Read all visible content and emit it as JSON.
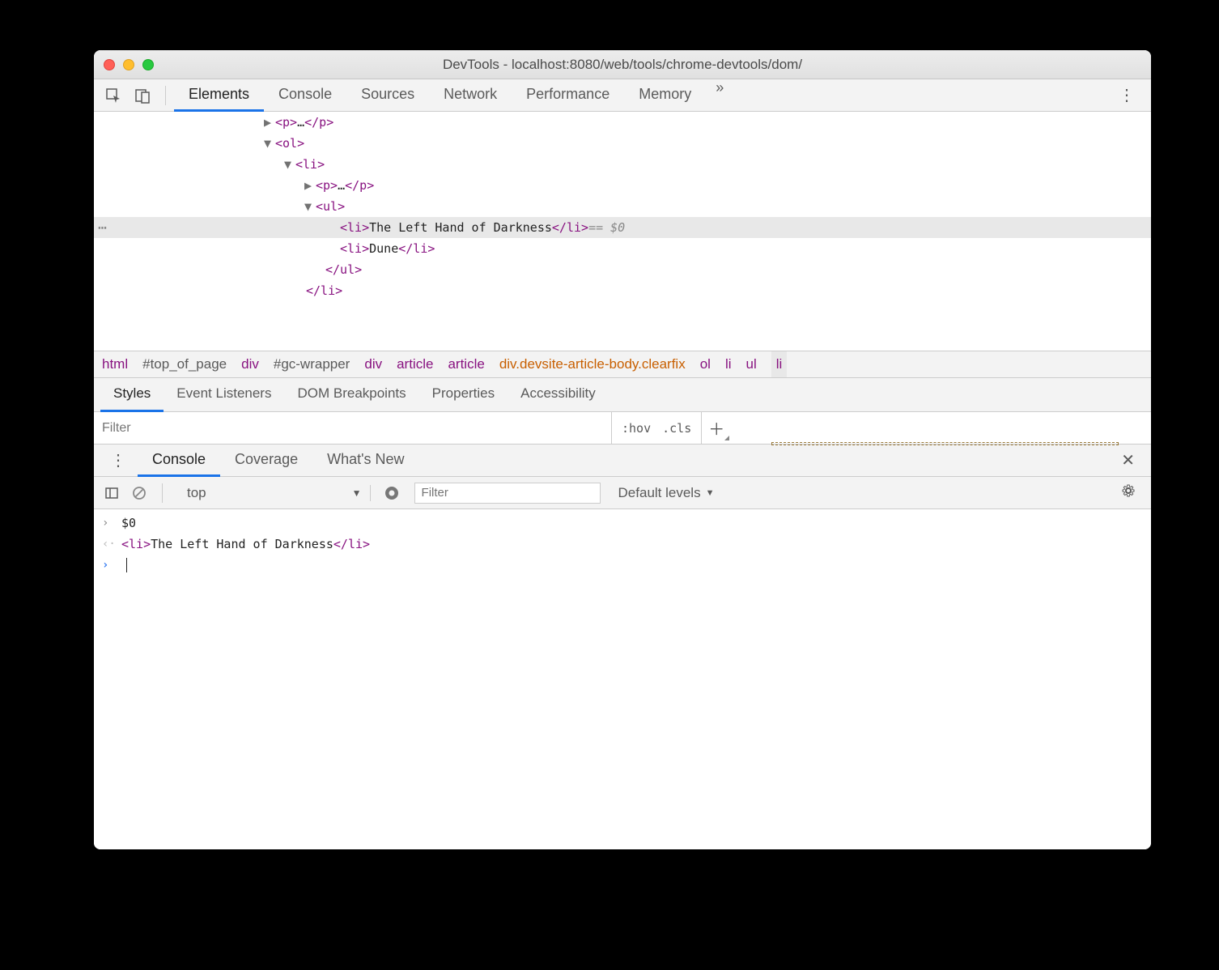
{
  "window": {
    "title": "DevTools - localhost:8080/web/tools/chrome-devtools/dom/"
  },
  "main_tabs": [
    "Elements",
    "Console",
    "Sources",
    "Network",
    "Performance",
    "Memory"
  ],
  "main_tabs_active": "Elements",
  "dom_tree": {
    "lines": [
      {
        "indent": 200,
        "arrow": "▶",
        "html": "<p>…</p>",
        "selected": false
      },
      {
        "indent": 200,
        "arrow": "▼",
        "html": "<ol>",
        "selected": false
      },
      {
        "indent": 225,
        "arrow": "▼",
        "html": "<li>",
        "selected": false
      },
      {
        "indent": 250,
        "arrow": "▶",
        "html": "<p>…</p>",
        "selected": false
      },
      {
        "indent": 250,
        "arrow": "▼",
        "html": "<ul>",
        "selected": false
      },
      {
        "indent": 280,
        "arrow": "",
        "html": "<li>The Left Hand of Darkness</li>",
        "selected": true,
        "eq0": true
      },
      {
        "indent": 280,
        "arrow": "",
        "html": "<li>Dune</li>",
        "selected": false
      },
      {
        "indent": 262,
        "arrow": "",
        "html": "</ul>",
        "selected": false
      },
      {
        "indent": 238,
        "arrow": "",
        "html": "</li>",
        "selected": false
      }
    ]
  },
  "breadcrumb": [
    {
      "text": "html",
      "cls": "tag"
    },
    {
      "text": "#top_of_page",
      "cls": "id"
    },
    {
      "text": "div",
      "cls": "tag"
    },
    {
      "text": "#gc-wrapper",
      "cls": "id"
    },
    {
      "text": "div",
      "cls": "tag"
    },
    {
      "text": "article",
      "cls": "tag"
    },
    {
      "text": "article",
      "cls": "tag"
    },
    {
      "text": "div.devsite-article-body.clearfix",
      "cls": "orange"
    },
    {
      "text": "ol",
      "cls": "tag"
    },
    {
      "text": "li",
      "cls": "tag"
    },
    {
      "text": "ul",
      "cls": "tag"
    },
    {
      "text": "li",
      "cls": "tag",
      "active": true
    }
  ],
  "styles_tabs": [
    "Styles",
    "Event Listeners",
    "DOM Breakpoints",
    "Properties",
    "Accessibility"
  ],
  "styles_tabs_active": "Styles",
  "styles_filter_placeholder": "Filter",
  "hov_label": ":hov",
  "cls_label": ".cls",
  "drawer_tabs": [
    "Console",
    "Coverage",
    "What's New"
  ],
  "drawer_tabs_active": "Console",
  "console": {
    "context": "top",
    "filter_placeholder": "Filter",
    "levels": "Default levels",
    "input_expr": "$0",
    "output_html": "<li>The Left Hand of Darkness</li>"
  }
}
